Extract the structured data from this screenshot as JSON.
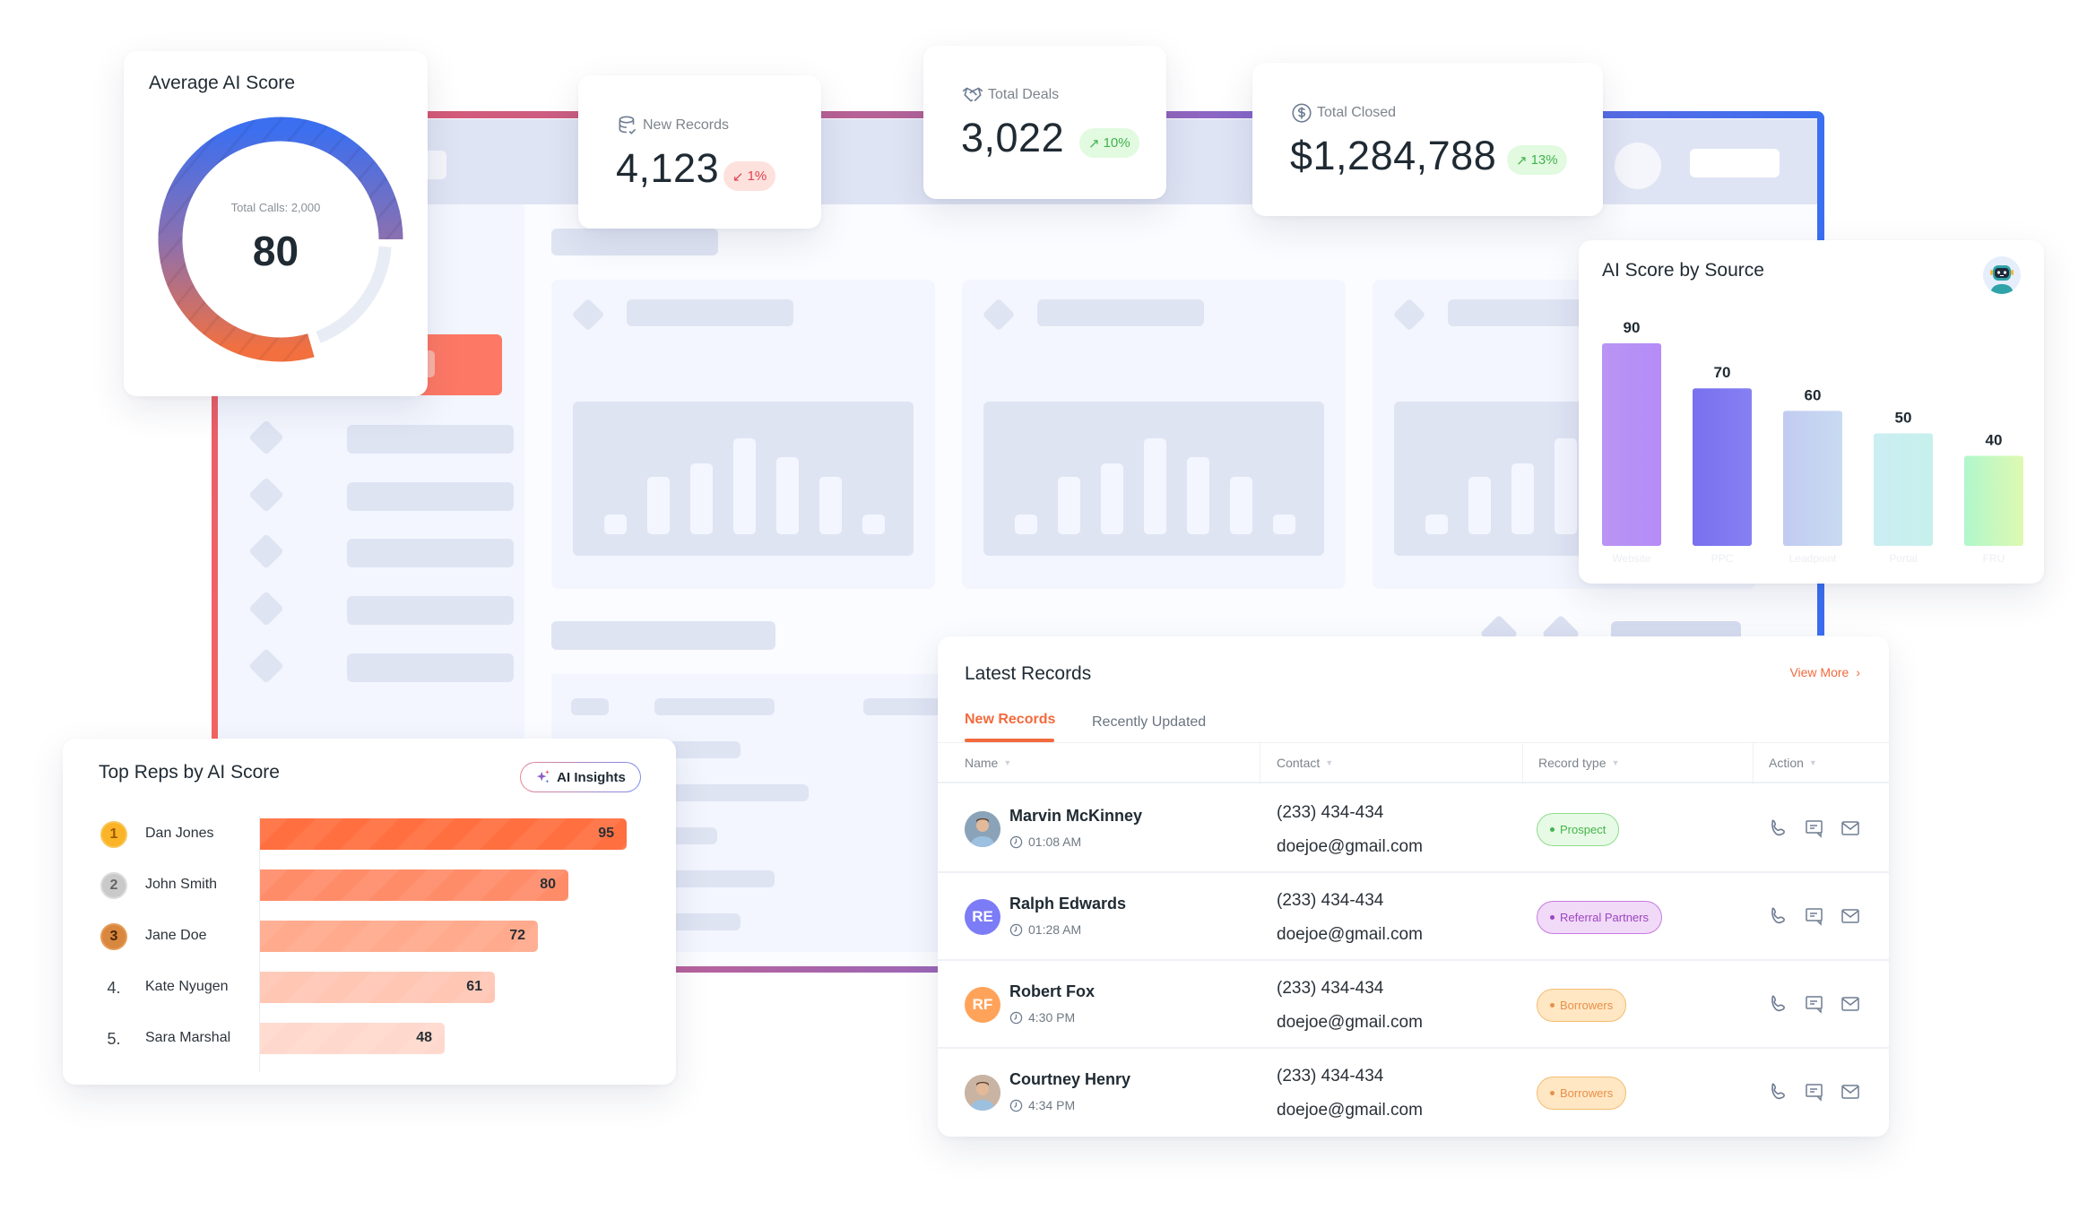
{
  "average_ai_score": {
    "title": "Average AI Score",
    "subtitle": "Total Calls: 2,000",
    "value": "80",
    "score_fraction": 0.8
  },
  "kpis": [
    {
      "label": "New Records",
      "icon": "database-check-icon",
      "value": "4,123",
      "change": "1%",
      "direction": "down",
      "arrow": "↙"
    },
    {
      "label": "Total Deals",
      "icon": "handshake-icon",
      "value": "3,022",
      "change": "10%",
      "direction": "up",
      "arrow": "↗"
    },
    {
      "label": "Total Closed",
      "icon": "dollar-circle-icon",
      "value": "$1,284,788",
      "change": "13%",
      "direction": "up",
      "arrow": "↗"
    }
  ],
  "ai_score_by_source": {
    "title": "AI Score by Source",
    "avatar_icon": "robot-avatar-icon"
  },
  "chart_data": [
    {
      "type": "bar",
      "title": "AI Score by Source",
      "categories": [
        "Website",
        "PPC",
        "Leadpoint",
        "Portal",
        "FRU"
      ],
      "values": [
        90,
        70,
        60,
        50,
        40
      ],
      "colors": [
        [
          "#b894f3",
          "#b68cf8"
        ],
        [
          "#7870ee",
          "#8680f2"
        ],
        [
          "#c2cbf1",
          "#c8daf2"
        ],
        [
          "#cbeef2",
          "#c6f0ec"
        ],
        [
          "#b0f7cc",
          "#def9b1"
        ]
      ],
      "xlabel": "",
      "ylabel": "",
      "ylim": [
        0,
        100
      ],
      "grid": false,
      "data_labels": true
    },
    {
      "type": "bar",
      "orientation": "horizontal",
      "title": "Top Reps by AI Score",
      "categories": [
        "Dan Jones",
        "John Smith",
        "Jane Doe",
        "Kate Nyugen",
        "Sara Marshal"
      ],
      "values": [
        95,
        80,
        72,
        61,
        48
      ],
      "xlim": [
        0,
        100
      ],
      "data_labels": true
    }
  ],
  "top_reps": {
    "title": "Top Reps by AI Score",
    "ai_insights_label": "AI Insights",
    "reps": [
      {
        "rank": "1",
        "medal": "gold",
        "name": "Dan Jones",
        "score": "95",
        "value": 95,
        "color": "#ff6f40"
      },
      {
        "rank": "2",
        "medal": "silver",
        "name": "John Smith",
        "score": "80",
        "value": 80,
        "color": "#ff8c69"
      },
      {
        "rank": "3",
        "medal": "bronze",
        "name": "Jane Doe",
        "score": "72",
        "value": 72,
        "color": "#ffaa8c"
      },
      {
        "rank": "4.",
        "medal": "none",
        "name": "Kate Nyugen",
        "score": "61",
        "value": 61,
        "color": "#ffc6b4"
      },
      {
        "rank": "5.",
        "medal": "none",
        "name": "Sara Marshal",
        "score": "48",
        "value": 48,
        "color": "#ffd8cd"
      }
    ]
  },
  "latest_records": {
    "title": "Latest Records",
    "view_more": "View More",
    "tabs": [
      {
        "label": "New Records",
        "active": true
      },
      {
        "label": "Recently Updated",
        "active": false
      }
    ],
    "columns": [
      "Name",
      "Contact",
      "Record type",
      "Action"
    ],
    "rows": [
      {
        "name": "Marvin McKinney",
        "time": "01:08 AM",
        "avatar": "photo",
        "initials": "",
        "avatar_color": "#8aa3b8",
        "phone": "(233) 434-434",
        "email": "doejoe@gmail.com",
        "type": "Prospect",
        "type_style": "green"
      },
      {
        "name": "Ralph Edwards",
        "time": "01:28 AM",
        "avatar": "initials",
        "initials": "RE",
        "avatar_color": "#7c7cf7",
        "phone": "(233) 434-434",
        "email": "doejoe@gmail.com",
        "type": "Referral Partners",
        "type_style": "purple"
      },
      {
        "name": "Robert Fox",
        "time": "4:30 PM",
        "avatar": "initials",
        "initials": "RF",
        "avatar_color": "#ffa35a",
        "phone": "(233) 434-434",
        "email": "doejoe@gmail.com",
        "type": "Borrowers",
        "type_style": "orange"
      },
      {
        "name": "Courtney Henry",
        "time": "4:34 PM",
        "avatar": "photo",
        "initials": "",
        "avatar_color": "#c9b3a3",
        "phone": "(233) 434-434",
        "email": "doejoe@gmail.com",
        "type": "Borrowers",
        "type_style": "orange"
      }
    ],
    "actions": [
      "phone-icon",
      "message-icon",
      "mail-icon"
    ]
  },
  "colors": {
    "accent": "#f26a3d",
    "donut_gradient": [
      "#3b6ff0",
      "#8b70b0",
      "#f2703f"
    ],
    "badge_down": "#e0424f",
    "badge_up": "#44b24d"
  }
}
